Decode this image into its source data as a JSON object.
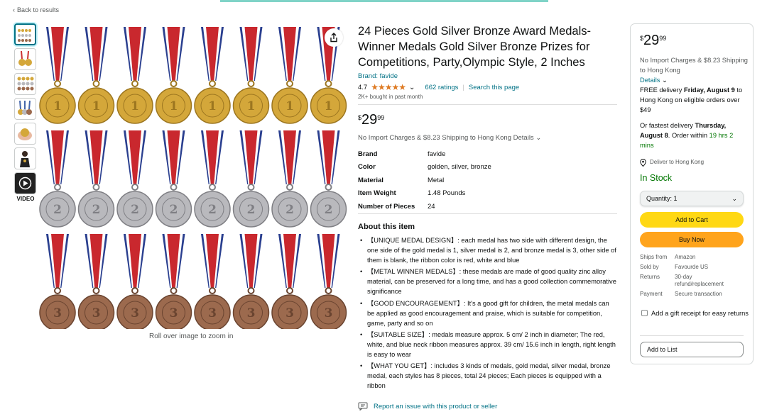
{
  "nav": {
    "back_label": "Back to results",
    "back_icon": "chevron-left-icon"
  },
  "gallery": {
    "thumbnails": [
      {
        "name": "medals-grid"
      },
      {
        "name": "medal-pair"
      },
      {
        "name": "medal-rows"
      },
      {
        "name": "medal-ribbons"
      },
      {
        "name": "medal-in-hand"
      },
      {
        "name": "person-wearing-medal"
      },
      {
        "name": "video-thumbnail"
      }
    ],
    "video_label": "VIDEO",
    "zoom_hint": "Roll over image to zoom in",
    "medal_rows": [
      "1",
      "2",
      "3"
    ],
    "medals_per_row": 8
  },
  "product": {
    "title": "24 Pieces Gold Silver Bronze Award Medals-Winner Medals Gold Silver Bronze Prizes for Competitions, Party,Olympic Style, 2 Inches",
    "brand": "Brand: favide",
    "rating": "4.7",
    "ratings_count": "662 ratings",
    "search_page": "Search this page",
    "bought": "2K+ bought in past month",
    "price_whole": "29",
    "price_fraction": "99",
    "currency": "$",
    "import_text": "No Import Charges & $8.23 Shipping to Hong Kong",
    "details_link": "Details",
    "specs": [
      {
        "key": "Brand",
        "value": "favide"
      },
      {
        "key": "Color",
        "value": "golden, silver, bronze"
      },
      {
        "key": "Material",
        "value": "Metal"
      },
      {
        "key": "Item Weight",
        "value": "1.48 Pounds"
      },
      {
        "key": "Number of Pieces",
        "value": "24"
      }
    ],
    "about_title": "About this item",
    "bullets": [
      "【UNIQUE MEDAL DESIGN】: each medal has two side with different design, the one side of the gold medal is 1, silver medal is 2, and bronze medal is 3, other side of them is blank, the ribbon color is red, white and blue",
      "【METAL WINNER MEDALS】: these medals are made of good quality zinc alloy material, can be preserved for a long time, and has a good collection commemorative significance",
      "【GOOD ENCOURAGEMENT】: It's a good gift for children, the metal medals can be applied as good encouragement and praise, which is suitable for competition, game, party and so on",
      "【SUITABLE SIZE】: medals measure approx. 5 cm/ 2 inch in diameter; The red, white, and blue neck ribbon measures approx. 39 cm/ 15.6 inch in length, right length is easy to wear",
      "【WHAT YOU GET】: includes 3 kinds of medals, gold medal, silver medal, bronze medal, each styles has 8 pieces, total 24 pieces; Each pieces is equipped with a ribbon"
    ],
    "report_label": "Report an issue with this product or seller"
  },
  "buybox": {
    "price_whole": "29",
    "price_fraction": "99",
    "currency": "$",
    "import_text": "No Import Charges & $8.23 Shipping to Hong Kong",
    "details_link": "Details",
    "free_delivery_pre": "FREE delivery",
    "free_delivery_date": "Friday, August 9",
    "free_delivery_post": "to Hong Kong on eligible orders over $49",
    "fastest_pre": "Or fastest delivery",
    "fastest_date": "Thursday, August 8",
    "fastest_mid": ". Order within",
    "fastest_time": "19 hrs 2 mins",
    "deliver_to": "Deliver to Hong Kong",
    "stock": "In Stock",
    "quantity_label": "Quantity: 1",
    "add_to_cart": "Add to Cart",
    "buy_now": "Buy Now",
    "info": [
      {
        "key": "Ships from",
        "value": "Amazon"
      },
      {
        "key": "Sold by",
        "value": "Favourde US"
      },
      {
        "key": "Returns",
        "value": "30-day refund/replacement"
      },
      {
        "key": "Payment",
        "value": "Secure transaction"
      }
    ],
    "gift_label": "Add a gift receipt for easy returns",
    "add_to_list": "Add to List"
  },
  "colors": {
    "link": "#007185",
    "star": "#de7921",
    "in_stock": "#007600",
    "cart_button": "#ffd814",
    "buy_button": "#ffa41c",
    "gold": "#d4a73a",
    "silver": "#b9b9bd",
    "bronze": "#9c6a4e"
  }
}
